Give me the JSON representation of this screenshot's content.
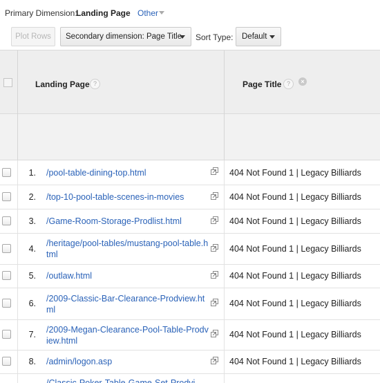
{
  "primary_dimension": {
    "label": "Primary Dimension:",
    "value": "Landing Page",
    "other": "Other"
  },
  "toolbar": {
    "plot_rows": "Plot Rows",
    "secondary_dimension": "Secondary dimension: Page Title",
    "sort_type_label": "Sort Type:",
    "sort_type_value": "Default"
  },
  "table": {
    "columns": {
      "landing_page": "Landing Page",
      "page_title": "Page Title",
      "help": "?"
    },
    "rows": [
      {
        "num": "1.",
        "landing_page": "/pool-table-dining-top.html",
        "page_title": "404 Not Found 1 | Legacy Billiards"
      },
      {
        "num": "2.",
        "landing_page": "/top-10-pool-table-scenes-in-movies",
        "page_title": "404 Not Found 1 | Legacy Billiards"
      },
      {
        "num": "3.",
        "landing_page": "/Game-Room-Storage-Prodlist.html",
        "page_title": "404 Not Found 1 | Legacy Billiards"
      },
      {
        "num": "4.",
        "landing_page": "/heritage/pool-tables/mustang-pool-table.html",
        "page_title": "404 Not Found 1 | Legacy Billiards"
      },
      {
        "num": "5.",
        "landing_page": "/outlaw.html",
        "page_title": "404 Not Found 1 | Legacy Billiards"
      },
      {
        "num": "6.",
        "landing_page": "/2009-Classic-Bar-Clearance-Prodview.html",
        "page_title": "404 Not Found 1 | Legacy Billiards"
      },
      {
        "num": "7.",
        "landing_page": "/2009-Megan-Clearance-Pool-Table-Prodview.html",
        "page_title": "404 Not Found 1 | Legacy Billiards"
      },
      {
        "num": "8.",
        "landing_page": "/admin/logon.asp",
        "page_title": "404 Not Found 1 | Legacy Billiards"
      },
      {
        "num": "",
        "landing_page": "/Classic-Poker-Table-Game-Set-Prodvi",
        "page_title": ""
      }
    ]
  }
}
